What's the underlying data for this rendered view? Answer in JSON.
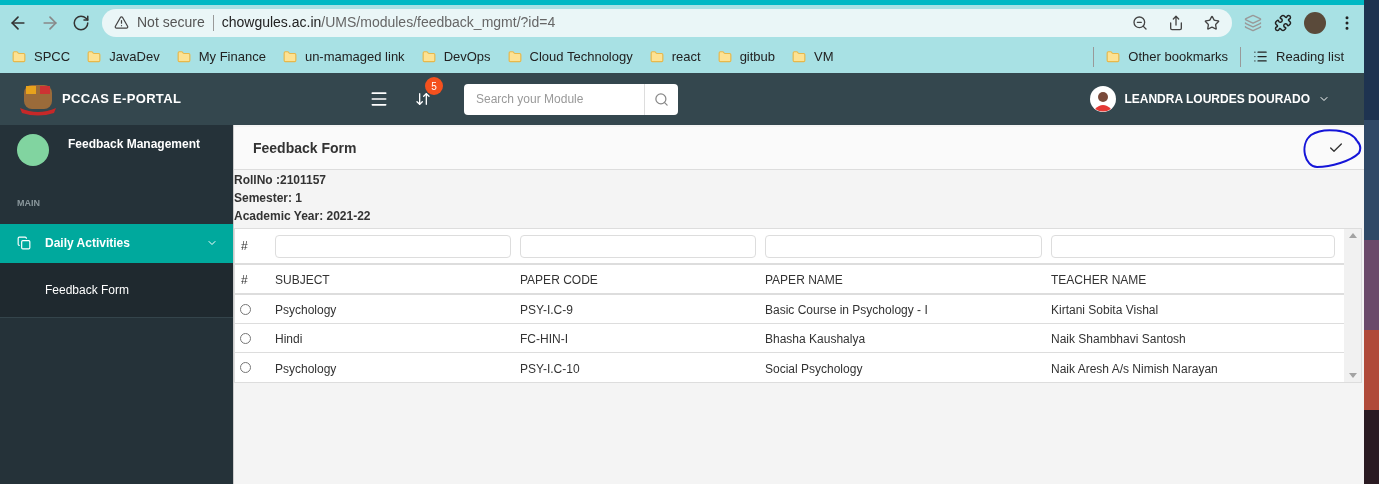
{
  "browser": {
    "url_warning": "Not secure",
    "url_host": "chowgules.ac.in",
    "url_path": "/UMS/modules/feedback_mgmt/?id=4",
    "bookmarks": [
      "SPCC",
      "JavaDev",
      "My Finance",
      "un-mamaged link",
      "DevOps",
      "Cloud Technology",
      "react",
      "gitbub",
      "VM"
    ],
    "other_bookmarks": "Other bookmarks",
    "reading_list": "Reading list"
  },
  "header": {
    "brand": "PCCAS E-PORTAL",
    "notification_count": "5",
    "search": {
      "placeholder": "Search your Module"
    },
    "user_name": "LEANDRA LOURDES DOURADO"
  },
  "sidebar": {
    "module_title": "Feedback Management",
    "section_label": "MAIN",
    "items": [
      {
        "label": "Daily Activities",
        "expanded": true,
        "children": [
          {
            "label": "Feedback Form"
          }
        ]
      }
    ]
  },
  "page": {
    "title": "Feedback Form",
    "info": [
      "RollNo :2101157",
      "Semester: 1",
      "Academic Year: 2021-22"
    ],
    "table": {
      "filter_label": "#",
      "columns": [
        "#",
        "SUBJECT",
        "PAPER CODE",
        "PAPER NAME",
        "TEACHER NAME"
      ],
      "rows": [
        {
          "selected": false,
          "subject": "Psychology",
          "paper_code": "PSY-I.C-9",
          "paper_name": "Basic Course in Psychology - I",
          "teacher": "Kirtani Sobita Vishal"
        },
        {
          "selected": false,
          "subject": "Hindi",
          "paper_code": "FC-HIN-I",
          "paper_name": "Bhasha Kaushalya",
          "teacher": "Naik Shambhavi Santosh"
        },
        {
          "selected": false,
          "subject": "Psychology",
          "paper_code": "PSY-I.C-10",
          "paper_name": "Social Psychology",
          "teacher": "Naik Aresh A/s Nimish Narayan"
        }
      ]
    }
  }
}
